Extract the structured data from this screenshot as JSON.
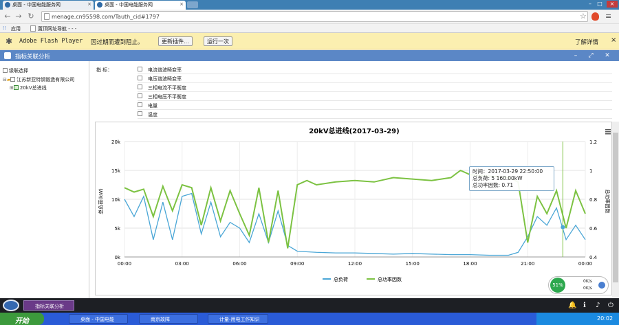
{
  "browser": {
    "tabs": [
      {
        "label": "桌面 - 中国电能服务网"
      },
      {
        "label": "桌面 - 中国电能服务网"
      }
    ],
    "url": "menage.cn95598.com/Tauth_cid#1797",
    "bookmarks": [
      "应用",
      "置顶网址导航 - - -"
    ]
  },
  "flash": {
    "product": "Adobe Flash Player",
    "message": "因过期而遭到阻止。",
    "update_label": "更新插件...",
    "run_label": "运行一次",
    "details_label": "了解详情"
  },
  "app": {
    "title": "指标关联分析"
  },
  "tree": {
    "root": "级联选择",
    "company": "江苏新亚特钢锻造有限公司",
    "line": "20kV总进线"
  },
  "indicators": {
    "label": "指 标：",
    "items": [
      "电流谐波畸变率",
      "电压谐波畸变率",
      "三相电流不平衡度",
      "三相电压不平衡度",
      "电量",
      "温度"
    ]
  },
  "chart_data": {
    "type": "line",
    "title": "20kV总进线(2017-03-29)",
    "ylabel": "总负荷(kW)",
    "y2label": "总功率因数",
    "x_ticks": [
      "00:00",
      "03:00",
      "06:00",
      "09:00",
      "12:00",
      "15:00",
      "18:00",
      "21:00",
      "00:00"
    ],
    "y_ticks": [
      "0k",
      "5k",
      "10k",
      "15k",
      "20k"
    ],
    "y2_ticks": [
      "0.4",
      "0.6",
      "0.8",
      "1",
      "1.2"
    ],
    "ylim": [
      0,
      20000
    ],
    "y2lim": [
      0.4,
      1.2
    ],
    "series": [
      {
        "name": "总负荷",
        "color": "#4aa6d6",
        "x": [
          0,
          0.5,
          1,
          1.5,
          2,
          2.5,
          3,
          3.5,
          4,
          4.5,
          5,
          5.5,
          6,
          6.5,
          7,
          7.5,
          8,
          8.5,
          9,
          10,
          11,
          12,
          13,
          14,
          15,
          16,
          17,
          18,
          19,
          20,
          20.5,
          21,
          21.5,
          22,
          22.5,
          23,
          23.5,
          24
        ],
        "y": [
          10000,
          7000,
          10500,
          3000,
          9500,
          3000,
          10500,
          11000,
          4000,
          9500,
          3500,
          6000,
          5000,
          2500,
          7500,
          2500,
          8000,
          2000,
          1000,
          800,
          700,
          700,
          600,
          500,
          600,
          500,
          400,
          400,
          300,
          300,
          800,
          3500,
          7000,
          5500,
          8500,
          3000,
          5500,
          3000
        ]
      },
      {
        "name": "总功率因数",
        "color": "#7cc242",
        "x": [
          0,
          0.5,
          1,
          1.5,
          2,
          2.5,
          3,
          3.5,
          4,
          4.5,
          5,
          5.5,
          6,
          6.5,
          7,
          7.5,
          8,
          8.5,
          9,
          9.5,
          10,
          11,
          12,
          13,
          14,
          15,
          16,
          17,
          17.5,
          18,
          19,
          20,
          20.5,
          21,
          21.5,
          22,
          22.5,
          23,
          23.5,
          24
        ],
        "y": [
          0.88,
          0.85,
          0.87,
          0.68,
          0.89,
          0.72,
          0.9,
          0.88,
          0.62,
          0.88,
          0.65,
          0.86,
          0.7,
          0.55,
          0.88,
          0.5,
          0.86,
          0.46,
          0.9,
          0.93,
          0.9,
          0.92,
          0.93,
          0.92,
          0.95,
          0.94,
          0.93,
          0.95,
          1.0,
          0.97,
          0.96,
          0.95,
          0.92,
          0.5,
          0.82,
          0.7,
          0.86,
          0.6,
          0.86,
          0.7
        ]
      }
    ],
    "tooltip": {
      "time": "时间：2017-03-29 22:50:00",
      "load": "总负荷: 5 160.00kW",
      "pf": "总功率因数: 0.71"
    },
    "grid": true,
    "legend": "bottom"
  },
  "widget": {
    "percent": "51%",
    "up": "0K/s",
    "down": "0K/s"
  },
  "taskbar": {
    "app_item": "指标关联分析",
    "start": "开始",
    "tasks": [
      "桌面 - 中国电能",
      "南京故障",
      "计量-用电工作知识"
    ],
    "clock": "20:02"
  }
}
